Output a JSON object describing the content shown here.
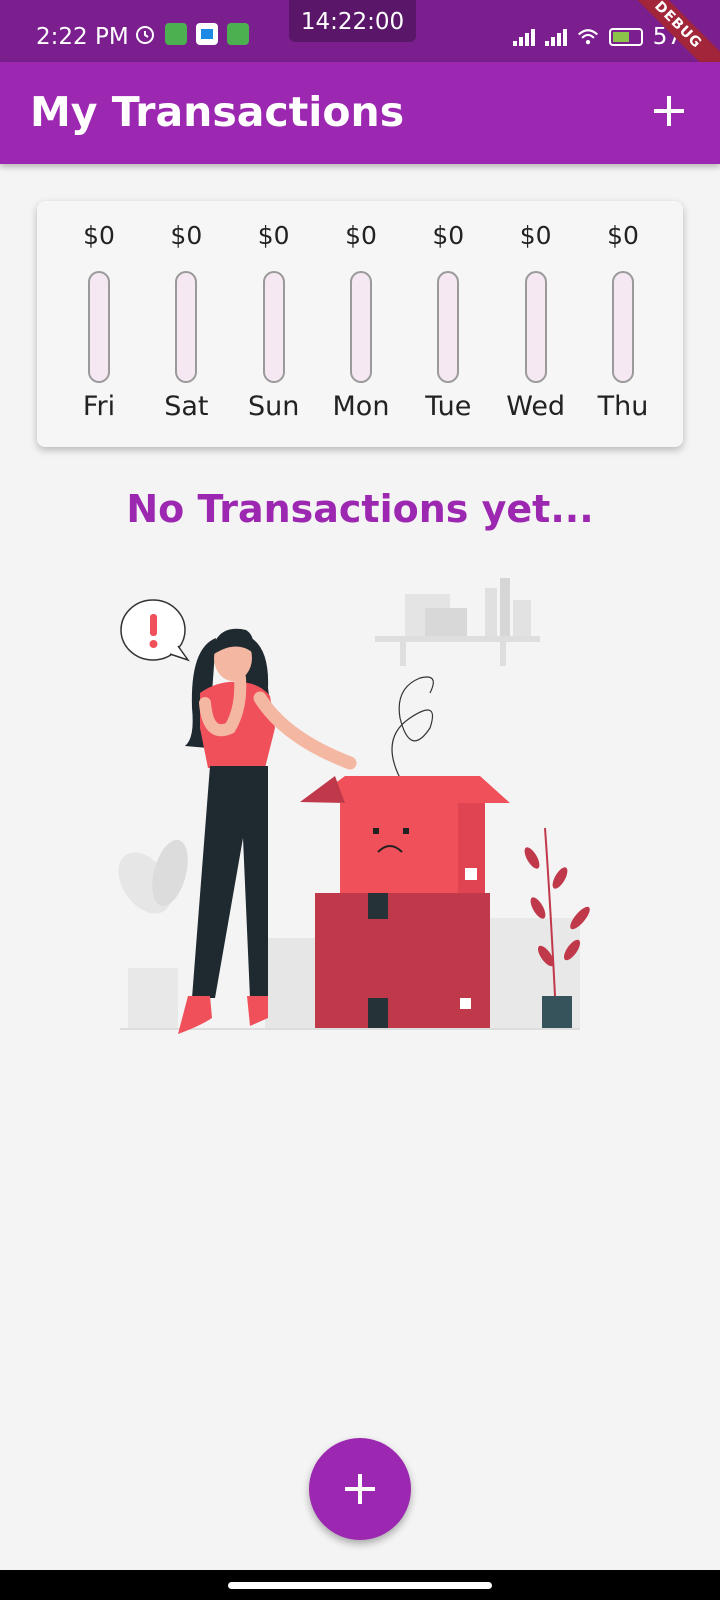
{
  "status_bar": {
    "time": "2:22 PM",
    "clock_overlay": "14:22:00",
    "battery_percent": "57",
    "debug_label": "DEBUG"
  },
  "app_bar": {
    "title": "My Transactions",
    "add_icon": "plus-icon"
  },
  "chart": {
    "days": [
      {
        "amount": "$0",
        "day": "Fri",
        "fill": 0
      },
      {
        "amount": "$0",
        "day": "Sat",
        "fill": 0
      },
      {
        "amount": "$0",
        "day": "Sun",
        "fill": 0
      },
      {
        "amount": "$0",
        "day": "Mon",
        "fill": 0
      },
      {
        "amount": "$0",
        "day": "Tue",
        "fill": 0
      },
      {
        "amount": "$0",
        "day": "Wed",
        "fill": 0
      },
      {
        "amount": "$0",
        "day": "Thu",
        "fill": 0
      }
    ]
  },
  "empty_state": {
    "message": "No Transactions yet..."
  },
  "fab": {
    "icon": "plus-icon"
  },
  "colors": {
    "primary": "#9c27b0",
    "status_bar": "#7b1f8f",
    "bar_track": "#f6e8f2",
    "illustration_accent": "#f0505a"
  }
}
